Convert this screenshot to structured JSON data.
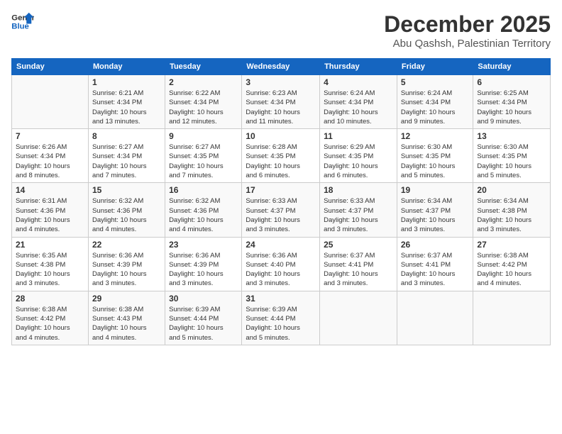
{
  "header": {
    "logo_line1": "General",
    "logo_line2": "Blue",
    "month_title": "December 2025",
    "location": "Abu Qashsh, Palestinian Territory"
  },
  "calendar": {
    "headers": [
      "Sunday",
      "Monday",
      "Tuesday",
      "Wednesday",
      "Thursday",
      "Friday",
      "Saturday"
    ],
    "weeks": [
      [
        {
          "day": "",
          "info": ""
        },
        {
          "day": "1",
          "info": "Sunrise: 6:21 AM\nSunset: 4:34 PM\nDaylight: 10 hours\nand 13 minutes."
        },
        {
          "day": "2",
          "info": "Sunrise: 6:22 AM\nSunset: 4:34 PM\nDaylight: 10 hours\nand 12 minutes."
        },
        {
          "day": "3",
          "info": "Sunrise: 6:23 AM\nSunset: 4:34 PM\nDaylight: 10 hours\nand 11 minutes."
        },
        {
          "day": "4",
          "info": "Sunrise: 6:24 AM\nSunset: 4:34 PM\nDaylight: 10 hours\nand 10 minutes."
        },
        {
          "day": "5",
          "info": "Sunrise: 6:24 AM\nSunset: 4:34 PM\nDaylight: 10 hours\nand 9 minutes."
        },
        {
          "day": "6",
          "info": "Sunrise: 6:25 AM\nSunset: 4:34 PM\nDaylight: 10 hours\nand 9 minutes."
        }
      ],
      [
        {
          "day": "7",
          "info": "Sunrise: 6:26 AM\nSunset: 4:34 PM\nDaylight: 10 hours\nand 8 minutes."
        },
        {
          "day": "8",
          "info": "Sunrise: 6:27 AM\nSunset: 4:34 PM\nDaylight: 10 hours\nand 7 minutes."
        },
        {
          "day": "9",
          "info": "Sunrise: 6:27 AM\nSunset: 4:35 PM\nDaylight: 10 hours\nand 7 minutes."
        },
        {
          "day": "10",
          "info": "Sunrise: 6:28 AM\nSunset: 4:35 PM\nDaylight: 10 hours\nand 6 minutes."
        },
        {
          "day": "11",
          "info": "Sunrise: 6:29 AM\nSunset: 4:35 PM\nDaylight: 10 hours\nand 6 minutes."
        },
        {
          "day": "12",
          "info": "Sunrise: 6:30 AM\nSunset: 4:35 PM\nDaylight: 10 hours\nand 5 minutes."
        },
        {
          "day": "13",
          "info": "Sunrise: 6:30 AM\nSunset: 4:35 PM\nDaylight: 10 hours\nand 5 minutes."
        }
      ],
      [
        {
          "day": "14",
          "info": "Sunrise: 6:31 AM\nSunset: 4:36 PM\nDaylight: 10 hours\nand 4 minutes."
        },
        {
          "day": "15",
          "info": "Sunrise: 6:32 AM\nSunset: 4:36 PM\nDaylight: 10 hours\nand 4 minutes."
        },
        {
          "day": "16",
          "info": "Sunrise: 6:32 AM\nSunset: 4:36 PM\nDaylight: 10 hours\nand 4 minutes."
        },
        {
          "day": "17",
          "info": "Sunrise: 6:33 AM\nSunset: 4:37 PM\nDaylight: 10 hours\nand 3 minutes."
        },
        {
          "day": "18",
          "info": "Sunrise: 6:33 AM\nSunset: 4:37 PM\nDaylight: 10 hours\nand 3 minutes."
        },
        {
          "day": "19",
          "info": "Sunrise: 6:34 AM\nSunset: 4:37 PM\nDaylight: 10 hours\nand 3 minutes."
        },
        {
          "day": "20",
          "info": "Sunrise: 6:34 AM\nSunset: 4:38 PM\nDaylight: 10 hours\nand 3 minutes."
        }
      ],
      [
        {
          "day": "21",
          "info": "Sunrise: 6:35 AM\nSunset: 4:38 PM\nDaylight: 10 hours\nand 3 minutes."
        },
        {
          "day": "22",
          "info": "Sunrise: 6:36 AM\nSunset: 4:39 PM\nDaylight: 10 hours\nand 3 minutes."
        },
        {
          "day": "23",
          "info": "Sunrise: 6:36 AM\nSunset: 4:39 PM\nDaylight: 10 hours\nand 3 minutes."
        },
        {
          "day": "24",
          "info": "Sunrise: 6:36 AM\nSunset: 4:40 PM\nDaylight: 10 hours\nand 3 minutes."
        },
        {
          "day": "25",
          "info": "Sunrise: 6:37 AM\nSunset: 4:41 PM\nDaylight: 10 hours\nand 3 minutes."
        },
        {
          "day": "26",
          "info": "Sunrise: 6:37 AM\nSunset: 4:41 PM\nDaylight: 10 hours\nand 3 minutes."
        },
        {
          "day": "27",
          "info": "Sunrise: 6:38 AM\nSunset: 4:42 PM\nDaylight: 10 hours\nand 4 minutes."
        }
      ],
      [
        {
          "day": "28",
          "info": "Sunrise: 6:38 AM\nSunset: 4:42 PM\nDaylight: 10 hours\nand 4 minutes."
        },
        {
          "day": "29",
          "info": "Sunrise: 6:38 AM\nSunset: 4:43 PM\nDaylight: 10 hours\nand 4 minutes."
        },
        {
          "day": "30",
          "info": "Sunrise: 6:39 AM\nSunset: 4:44 PM\nDaylight: 10 hours\nand 5 minutes."
        },
        {
          "day": "31",
          "info": "Sunrise: 6:39 AM\nSunset: 4:44 PM\nDaylight: 10 hours\nand 5 minutes."
        },
        {
          "day": "",
          "info": ""
        },
        {
          "day": "",
          "info": ""
        },
        {
          "day": "",
          "info": ""
        }
      ]
    ]
  }
}
